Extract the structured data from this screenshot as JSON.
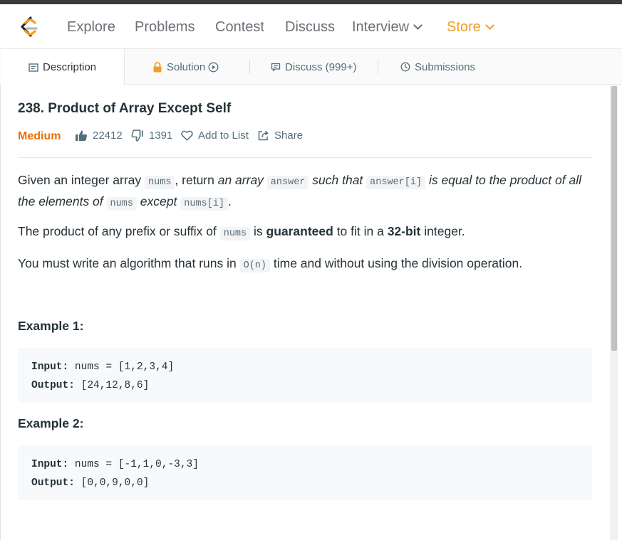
{
  "nav": {
    "items": [
      {
        "label": "Explore"
      },
      {
        "label": "Problems"
      },
      {
        "label": "Contest"
      },
      {
        "label": "Discuss"
      },
      {
        "label": "Interview"
      },
      {
        "label": "Store"
      }
    ],
    "store_color": "#f0a020"
  },
  "tabs": [
    {
      "label": "Description",
      "icon": "description-icon"
    },
    {
      "label": "Solution",
      "icon": "lock-icon"
    },
    {
      "label": "Discuss (999+)",
      "icon": "comment-icon"
    },
    {
      "label": "Submissions",
      "icon": "clock-icon"
    }
  ],
  "problem": {
    "title": "238. Product of Array Except Self",
    "difficulty": "Medium",
    "difficulty_color": "#ef6c00",
    "likes": "22412",
    "dislikes": "1391",
    "add_to_list": "Add to List",
    "share": "Share"
  },
  "description": {
    "p1": {
      "t1": "Given an integer array ",
      "c1": "nums",
      "t2": ", return ",
      "e1": "an array ",
      "c2": "answer",
      "e2": " such that ",
      "c3": "answer[i]",
      "e3": " is equal to the product of all the elements of ",
      "c4": "nums",
      "e4": " except ",
      "c5": "nums[i]",
      "t3": "."
    },
    "p2": {
      "t1": "The product of any prefix or suffix of ",
      "c1": "nums",
      "t2": " is ",
      "s1": "guaranteed",
      "t3": " to fit in a ",
      "s2": "32-bit",
      "t4": " integer."
    },
    "p3": {
      "t1": "You must write an algorithm that runs in ",
      "c1": "O(n)",
      "t2": " time and without using the division operation."
    }
  },
  "examples": [
    {
      "title": "Example 1:",
      "input_label": "Input:",
      "input": " nums = [1,2,3,4]",
      "output_label": "Output:",
      "output": " [24,12,8,6]"
    },
    {
      "title": "Example 2:",
      "input_label": "Input:",
      "input": " nums = [-1,1,0,-3,3]",
      "output_label": "Output:",
      "output": " [0,0,9,0,0]"
    }
  ]
}
